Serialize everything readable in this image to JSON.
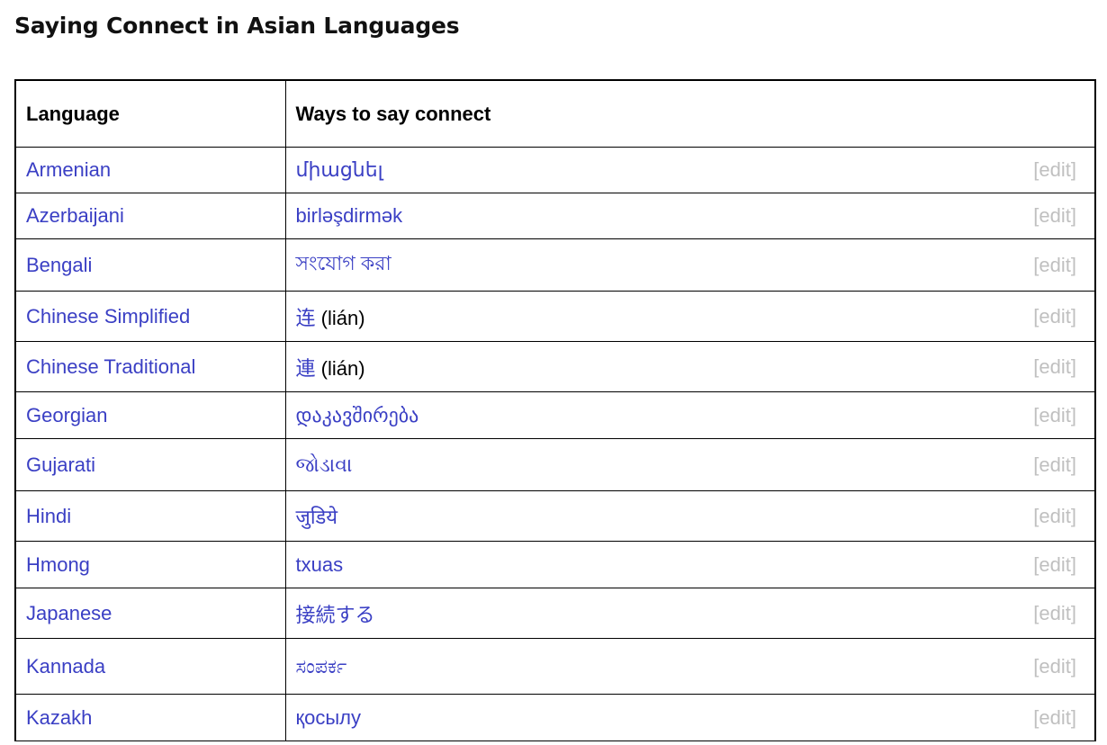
{
  "page": {
    "title": "Saying Connect in Asian Languages"
  },
  "colors": {
    "link": "#3a3fc4",
    "edit": "#c0c0c0",
    "border": "#000000"
  },
  "table": {
    "headers": [
      "Language",
      "Ways to say connect"
    ],
    "edit_label": "[edit]",
    "rows": [
      {
        "language": "Armenian",
        "word": "միացնել",
        "note": ""
      },
      {
        "language": "Azerbaijani",
        "word": "birləşdirmək",
        "note": ""
      },
      {
        "language": "Bengali",
        "word": "সংযোগ করা",
        "note": ""
      },
      {
        "language": "Chinese Simplified",
        "word": "连",
        "note": "(lián)"
      },
      {
        "language": "Chinese Traditional",
        "word": "連",
        "note": "(lián)"
      },
      {
        "language": "Georgian",
        "word": "დაკავშირება",
        "note": ""
      },
      {
        "language": "Gujarati",
        "word": "જોડાવા",
        "note": ""
      },
      {
        "language": "Hindi",
        "word": "जुडिये",
        "note": ""
      },
      {
        "language": "Hmong",
        "word": "txuas",
        "note": ""
      },
      {
        "language": "Japanese",
        "word": "接続する",
        "note": ""
      },
      {
        "language": "Kannada",
        "word": "ಸಂಪರ್ಕ",
        "note": ""
      },
      {
        "language": "Kazakh",
        "word": "қосылу",
        "note": ""
      }
    ]
  }
}
